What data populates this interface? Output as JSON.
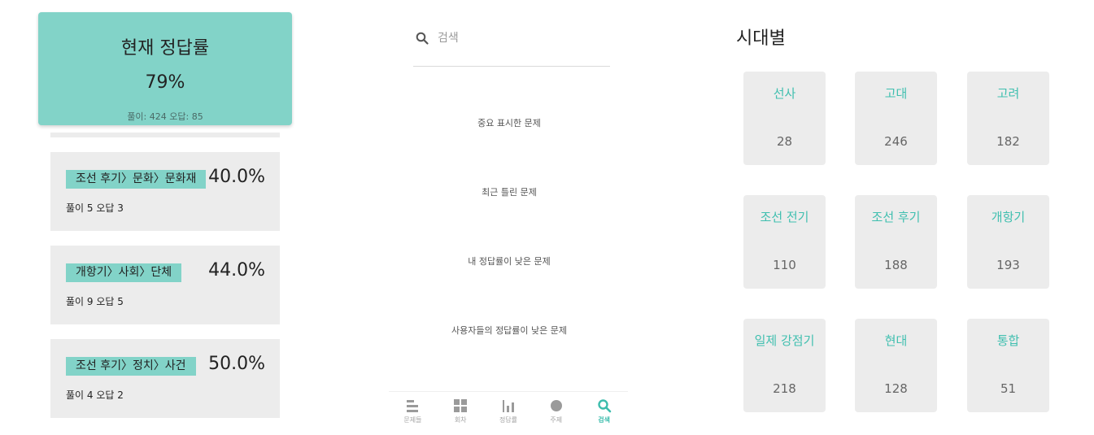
{
  "summary": {
    "title": "현재 정답률",
    "rate": "79%",
    "counts": "풀이: 424  오답: 85"
  },
  "stats": [
    {
      "category": "조선 후기〉문화〉문화재",
      "percent": "40.0%",
      "counts": "풀이 5 오답 3"
    },
    {
      "category": "개항기〉사회〉단체",
      "percent": "44.0%",
      "counts": "풀이 9 오답 5"
    },
    {
      "category": "조선 후기〉정치〉사건",
      "percent": "50.0%",
      "counts": "풀이 4 오답 2"
    }
  ],
  "search": {
    "placeholder": "검색",
    "value": "",
    "icon": "search-icon"
  },
  "menu": [
    {
      "label": "중요 표시한 문제"
    },
    {
      "label": "최근 틀린 문제"
    },
    {
      "label": "내 정답률이 낮은 문제"
    },
    {
      "label": "사용자들의 정답률이 낮은 문제"
    }
  ],
  "nav": {
    "items": [
      {
        "label": "문제들",
        "icon": "list-icon"
      },
      {
        "label": "회차",
        "icon": "grid-icon"
      },
      {
        "label": "정답률",
        "icon": "bar-chart-icon"
      },
      {
        "label": "주제",
        "icon": "circle-icon"
      },
      {
        "label": "검색",
        "icon": "search-icon",
        "active": true
      }
    ]
  },
  "eras": {
    "title": "시대별",
    "items": [
      {
        "name": "선사",
        "count": "28"
      },
      {
        "name": "고대",
        "count": "246"
      },
      {
        "name": "고려",
        "count": "182"
      },
      {
        "name": "조선 전기",
        "count": "110"
      },
      {
        "name": "조선 후기",
        "count": "188"
      },
      {
        "name": "개항기",
        "count": "193"
      },
      {
        "name": "일제 강점기",
        "count": "218"
      },
      {
        "name": "현대",
        "count": "128"
      },
      {
        "name": "통합",
        "count": "51"
      }
    ]
  },
  "colors": {
    "accent": "#82d3c8",
    "accent_text": "#3fbfaf",
    "card_bg": "#ececec"
  }
}
